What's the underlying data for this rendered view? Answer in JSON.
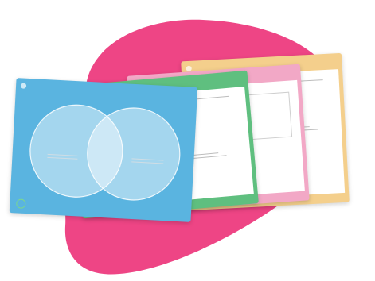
{
  "colors": {
    "blob": "#ee4585",
    "sheet_blue": "#5ab4e0",
    "sheet_green": "#5fbf7f",
    "sheet_pink": "#f2a8c6",
    "sheet_yellow": "#f4cf8c"
  },
  "sheets": [
    {
      "title": "",
      "footer": "",
      "icon": "circle-icon"
    },
    {
      "title": "",
      "footer": "",
      "icon": "circle-icon"
    },
    {
      "title": "",
      "footer": "",
      "icon": "circle-icon"
    },
    {
      "title": "",
      "footer": "",
      "icon": "circle-icon"
    }
  ],
  "venn": {
    "left_label": "",
    "right_label": ""
  },
  "logo_text": ""
}
